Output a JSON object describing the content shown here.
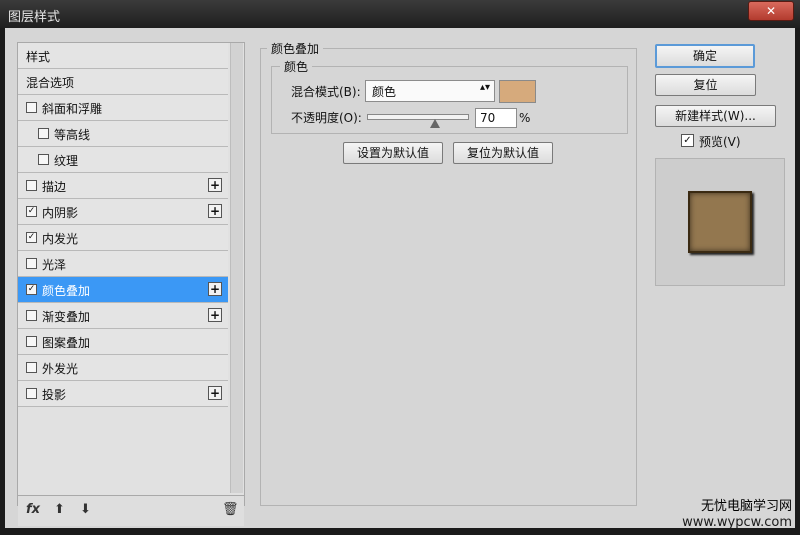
{
  "window": {
    "title": "图层样式",
    "close_label": "✕"
  },
  "left_panel": {
    "items": [
      {
        "label": "样式",
        "checkbox": null,
        "plus": false,
        "selected": false
      },
      {
        "label": "混合选项",
        "checkbox": null,
        "plus": false,
        "selected": false
      },
      {
        "label": "斜面和浮雕",
        "checkbox": false,
        "plus": false,
        "selected": false
      },
      {
        "label": "等高线",
        "checkbox": false,
        "plus": false,
        "selected": false,
        "indent": true
      },
      {
        "label": "纹理",
        "checkbox": false,
        "plus": false,
        "selected": false,
        "indent": true
      },
      {
        "label": "描边",
        "checkbox": false,
        "plus": true,
        "selected": false
      },
      {
        "label": "内阴影",
        "checkbox": true,
        "plus": true,
        "selected": false
      },
      {
        "label": "内发光",
        "checkbox": true,
        "plus": false,
        "selected": false
      },
      {
        "label": "光泽",
        "checkbox": false,
        "plus": false,
        "selected": false
      },
      {
        "label": "颜色叠加",
        "checkbox": true,
        "plus": true,
        "selected": true
      },
      {
        "label": "渐变叠加",
        "checkbox": false,
        "plus": true,
        "selected": false
      },
      {
        "label": "图案叠加",
        "checkbox": false,
        "plus": false,
        "selected": false
      },
      {
        "label": "外发光",
        "checkbox": false,
        "plus": false,
        "selected": false
      },
      {
        "label": "投影",
        "checkbox": false,
        "plus": true,
        "selected": false
      }
    ],
    "bottom": {
      "fx": "fx",
      "up": "⬆",
      "down": "⬇",
      "trash": "🗑"
    }
  },
  "main": {
    "section_title": "颜色叠加",
    "group_title": "颜色",
    "blend_mode_label": "混合模式(B):",
    "blend_mode_value": "颜色",
    "opacity_label": "不透明度(O):",
    "opacity_value": "70",
    "opacity_unit": "%",
    "opacity_level": 0.7,
    "overlay_color": "#d6aa7c",
    "set_default_label": "设置为默认值",
    "reset_default_label": "复位为默认值"
  },
  "right": {
    "ok_label": "确定",
    "reset_label": "复位",
    "new_style_label": "新建样式(W)...",
    "preview_label": "预览(V)",
    "preview_checked": true
  },
  "watermark": {
    "line1": "无忧电脑学习网",
    "line2": "www.wypcw.com"
  }
}
